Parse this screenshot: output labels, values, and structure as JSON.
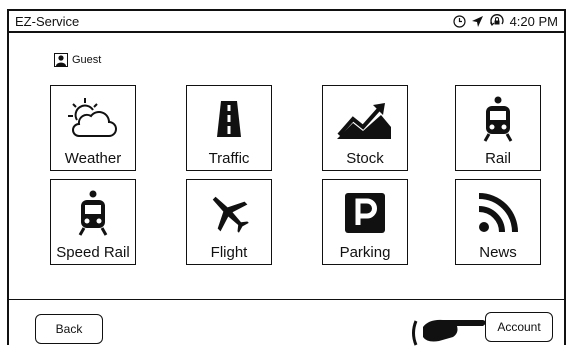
{
  "header": {
    "title": "EZ-Service",
    "time": "4:20 PM",
    "icons": [
      "clock-icon",
      "location-arrow-icon",
      "lock-rotation-icon"
    ]
  },
  "user": {
    "name": "Guest",
    "icon": "user-icon"
  },
  "tiles": [
    {
      "label": "Weather",
      "icon": "weather-icon"
    },
    {
      "label": "Traffic",
      "icon": "traffic-road-icon"
    },
    {
      "label": "Stock",
      "icon": "stock-chart-icon"
    },
    {
      "label": "Rail",
      "icon": "rail-train-icon"
    },
    {
      "label": "Speed Rail",
      "icon": "speed-rail-train-icon"
    },
    {
      "label": "Flight",
      "icon": "airplane-icon"
    },
    {
      "label": "Parking",
      "icon": "parking-icon"
    },
    {
      "label": "News",
      "icon": "rss-news-icon"
    }
  ],
  "footer": {
    "back_label": "Back",
    "account_label": "Account"
  }
}
